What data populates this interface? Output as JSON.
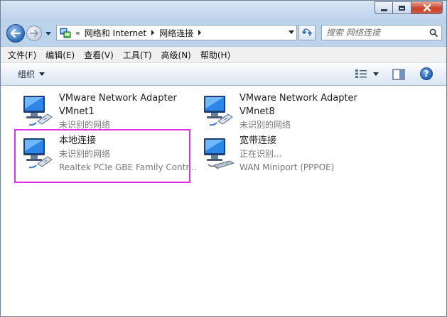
{
  "window": {
    "controls": {
      "minimize": "minimize",
      "maximize": "maximize",
      "close": "close"
    }
  },
  "nav": {
    "breadcrumb_overflow": "«",
    "breadcrumbs": [
      "网络和 Internet",
      "网络连接"
    ]
  },
  "search": {
    "placeholder": "搜索 网络连接"
  },
  "menu": {
    "items": [
      "文件(F)",
      "编辑(E)",
      "查看(V)",
      "工具(T)",
      "高级(N)",
      "帮助(H)"
    ]
  },
  "toolbar": {
    "organize_label": "组织",
    "help_label": "?"
  },
  "connections": [
    {
      "name": "VMware Network Adapter",
      "name2": "VMnet1",
      "status": "未识别的网络",
      "device": "",
      "icon": "network-computer-icon"
    },
    {
      "name": "VMware Network Adapter",
      "name2": "VMnet8",
      "status": "未识别的网络",
      "device": "",
      "icon": "network-computer-icon"
    },
    {
      "name": "本地连接",
      "name2": "",
      "status": "未识别的网络",
      "device": "Realtek PCIe GBE Family Contr...",
      "icon": "network-computer-icon"
    },
    {
      "name": "宽带连接",
      "name2": "",
      "status": "正在识别...",
      "device": "WAN Miniport (PPPOE)",
      "icon": "broadband-modem-icon"
    }
  ],
  "colors": {
    "highlight": "#e030e0",
    "secondary_text": "#777777"
  }
}
